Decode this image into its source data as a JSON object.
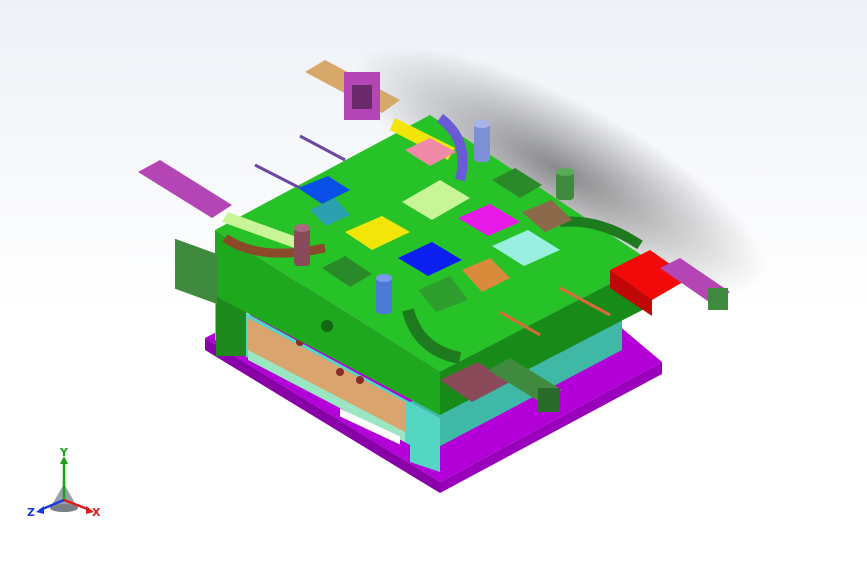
{
  "viewport": {
    "background_top": "#eef1f7",
    "background_bottom": "#ffffff"
  },
  "model": {
    "colors": {
      "base_plate": "#b300d9",
      "lower_block_face": "#54d6c3",
      "main_body": "#1ea81e",
      "main_body_top": "#27c227",
      "slider_red": "#f20a0a",
      "slider_blue": "#0a1ff0",
      "slider_yellow": "#f2e50a",
      "slider_pink": "#f08aa8",
      "slider_lightgreen": "#c8f598",
      "slider_magenta": "#e81ae8",
      "slider_cyan": "#9af0e0",
      "cylinder_purple": "#b445b4",
      "cylinder_tan": "#d6a96b",
      "post_blue": "#7f8fd6",
      "post_green": "#3f8a3f",
      "post_maroon": "#8a4a5a",
      "brown_block": "#8a6a4a",
      "dark_holder": "#6a4a4a"
    }
  },
  "triad": {
    "labels": {
      "y": "Y",
      "x": "X",
      "z": "Z"
    },
    "colors": {
      "y": "#1aa01a",
      "x": "#e01a1a",
      "z": "#1a3ae0"
    }
  }
}
